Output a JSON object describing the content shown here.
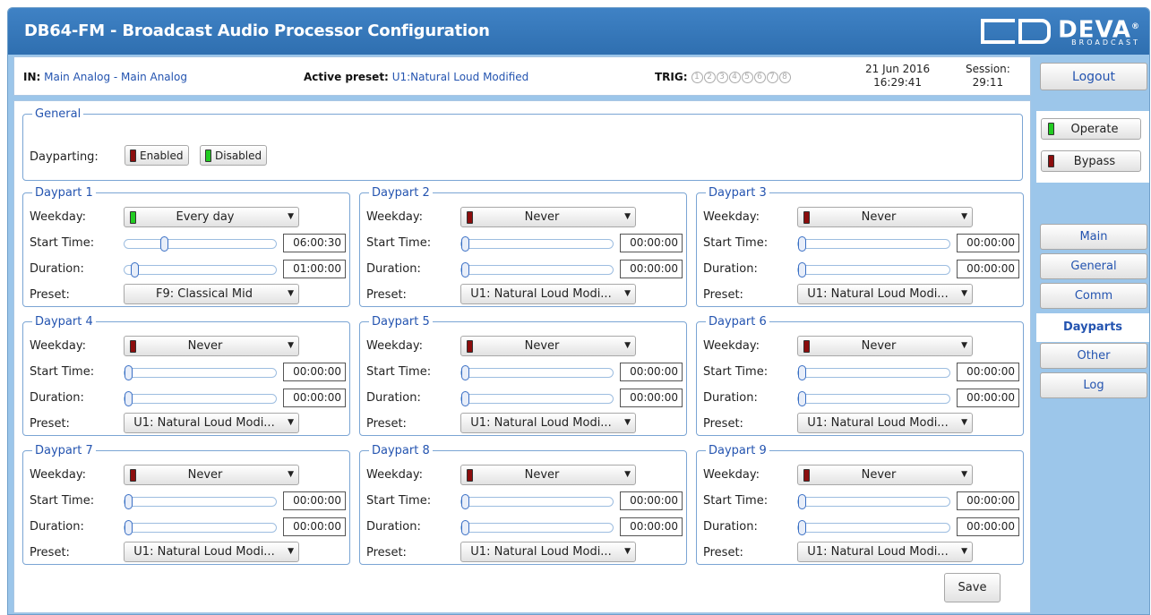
{
  "header": {
    "title": "DB64-FM - Broadcast Audio Processor Configuration",
    "logo_text": "DEVA",
    "logo_sub": "BROADCAST",
    "logo_reg": "®"
  },
  "info": {
    "in_label": "IN:",
    "in_value": "Main Analog - Main Analog",
    "preset_label": "Active preset:",
    "preset_value": "U1:Natural Loud Modified",
    "trig_label": "TRIG:",
    "trig_items": [
      "1",
      "2",
      "3",
      "4",
      "5",
      "6",
      "7",
      "8"
    ],
    "date": "21 Jun 2016",
    "time": "16:29:41",
    "session_label": "Session:",
    "session_value": "29:11"
  },
  "logout_label": "Logout",
  "general": {
    "legend": "General",
    "dayparting_label": "Dayparting:",
    "enabled_label": "Enabled",
    "disabled_label": "Disabled",
    "enabled_led": "#8c0d0d",
    "disabled_led": "#22cc22"
  },
  "labels": {
    "weekday": "Weekday:",
    "start": "Start Time:",
    "duration": "Duration:",
    "preset": "Preset:"
  },
  "dayparts": [
    {
      "legend": "Daypart 1",
      "weekday": "Every day",
      "weekday_led": "green",
      "start": "06:00:30",
      "start_frac": 0.25,
      "duration": "01:00:00",
      "duration_frac": 0.042,
      "preset": "F9: Classical Mid"
    },
    {
      "legend": "Daypart 2",
      "weekday": "Never",
      "weekday_led": "red",
      "start": "00:00:00",
      "start_frac": 0,
      "duration": "00:00:00",
      "duration_frac": 0,
      "preset": "U1: Natural Loud Modi..."
    },
    {
      "legend": "Daypart 3",
      "weekday": "Never",
      "weekday_led": "red",
      "start": "00:00:00",
      "start_frac": 0,
      "duration": "00:00:00",
      "duration_frac": 0,
      "preset": "U1: Natural Loud Modi..."
    },
    {
      "legend": "Daypart 4",
      "weekday": "Never",
      "weekday_led": "red",
      "start": "00:00:00",
      "start_frac": 0,
      "duration": "00:00:00",
      "duration_frac": 0,
      "preset": "U1: Natural Loud Modi..."
    },
    {
      "legend": "Daypart 5",
      "weekday": "Never",
      "weekday_led": "red",
      "start": "00:00:00",
      "start_frac": 0,
      "duration": "00:00:00",
      "duration_frac": 0,
      "preset": "U1: Natural Loud Modi..."
    },
    {
      "legend": "Daypart 6",
      "weekday": "Never",
      "weekday_led": "red",
      "start": "00:00:00",
      "start_frac": 0,
      "duration": "00:00:00",
      "duration_frac": 0,
      "preset": "U1: Natural Loud Modi..."
    },
    {
      "legend": "Daypart 7",
      "weekday": "Never",
      "weekday_led": "red",
      "start": "00:00:00",
      "start_frac": 0,
      "duration": "00:00:00",
      "duration_frac": 0,
      "preset": "U1: Natural Loud Modi..."
    },
    {
      "legend": "Daypart 8",
      "weekday": "Never",
      "weekday_led": "red",
      "start": "00:00:00",
      "start_frac": 0,
      "duration": "00:00:00",
      "duration_frac": 0,
      "preset": "U1: Natural Loud Modi..."
    },
    {
      "legend": "Daypart 9",
      "weekday": "Never",
      "weekday_led": "red",
      "start": "00:00:00",
      "start_frac": 0,
      "duration": "00:00:00",
      "duration_frac": 0,
      "preset": "U1: Natural Loud Modi..."
    }
  ],
  "save_label": "Save",
  "operate": {
    "operate_label": "Operate",
    "bypass_label": "Bypass",
    "operate_led": "#22cc22",
    "bypass_led": "#8c0d0d"
  },
  "nav": [
    {
      "label": "Main",
      "active": false
    },
    {
      "label": "General",
      "active": false
    },
    {
      "label": "Comm",
      "active": false
    },
    {
      "label": "Dayparts",
      "active": true
    },
    {
      "label": "Other",
      "active": false
    },
    {
      "label": "Log",
      "active": false
    }
  ]
}
